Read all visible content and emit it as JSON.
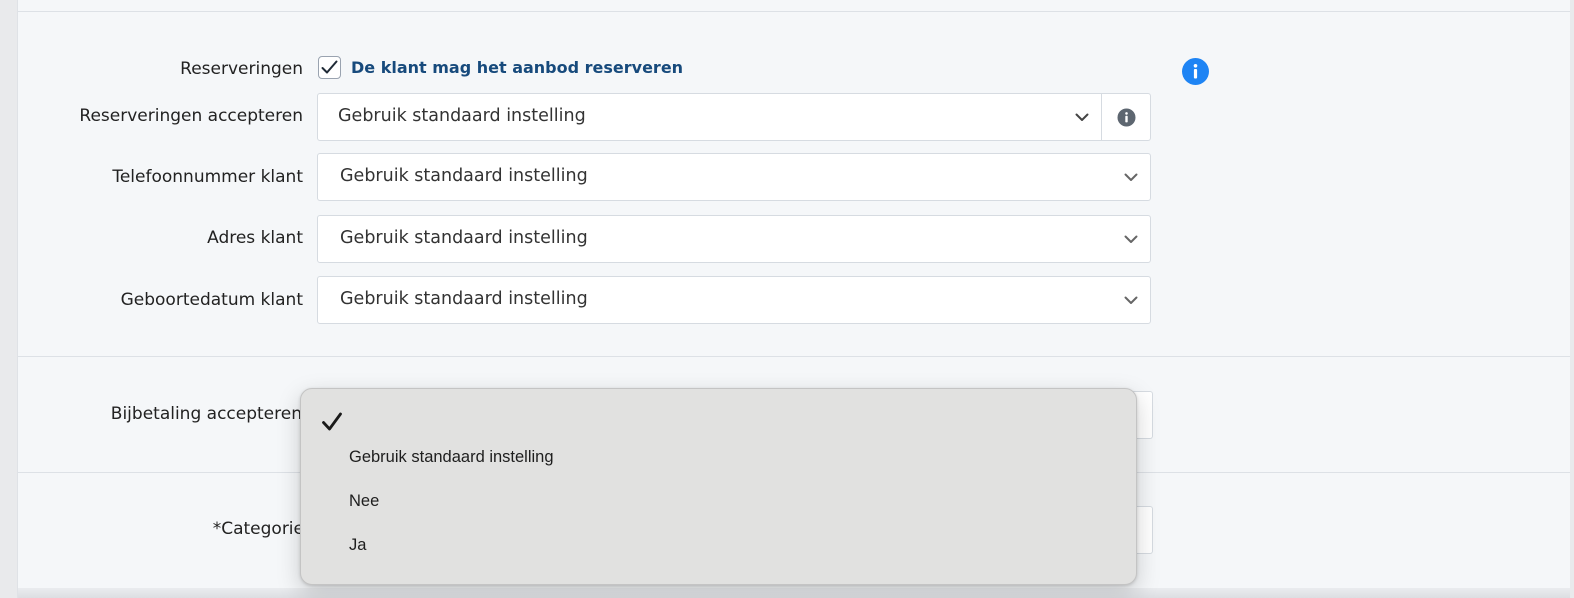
{
  "form": {
    "reservations": {
      "label": "Reserveringen",
      "checkbox_label": "De klant mag het aanbod reserveren",
      "checked": true
    },
    "accept_reservations": {
      "label": "Reserveringen accepteren",
      "value": "Gebruik standaard instelling"
    },
    "phone": {
      "label": "Telefoonnummer klant",
      "value": "Gebruik standaard instelling"
    },
    "address": {
      "label": "Adres klant",
      "value": "Gebruik standaard instelling"
    },
    "birthdate": {
      "label": "Geboortedatum klant",
      "value": "Gebruik standaard instelling"
    },
    "surcharge": {
      "label": "Bijbetaling accepteren"
    },
    "category": {
      "required_mark": "*",
      "label": "Categorie"
    }
  },
  "dropdown": {
    "options": [
      "Gebruik standaard instelling",
      "Nee",
      "Ja"
    ]
  },
  "icons": {
    "info_blue": "info-circle-icon",
    "info_gray": "info-circle-icon",
    "chevron": "chevron-down-icon",
    "check": "checkmark-icon"
  },
  "colors": {
    "accent_blue": "#1e84f4",
    "label_blue": "#174a7c",
    "dropdown_bg": "#e1e1e0"
  }
}
